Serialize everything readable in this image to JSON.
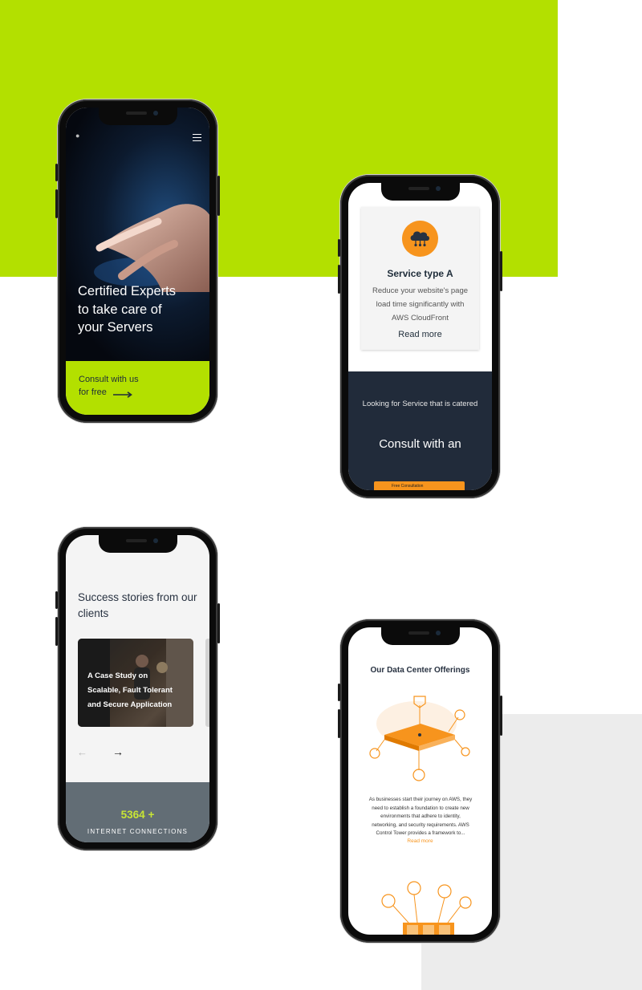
{
  "phone1": {
    "hero_title_lines": [
      "Certified Experts",
      "to take care of",
      "your Servers"
    ],
    "cta_lines": [
      "Consult with us",
      "for free"
    ],
    "menu_icon": "hamburger-menu-icon",
    "arrow_icon": "long-arrow-right-icon",
    "colors": {
      "accent": "#b3e000"
    }
  },
  "phone2": {
    "service_icon": "cloud-network-icon",
    "card_title": "Service type A",
    "card_desc_lines": [
      "Reduce your website's page",
      "load time significantly with",
      "AWS CloudFront"
    ],
    "card_link": "Read more",
    "navy_subtitle": "Looking for Service that is catered",
    "navy_title": "Consult with an",
    "navy_button": "Free Consultation",
    "colors": {
      "orange": "#f7941d",
      "navy": "#212b3a"
    }
  },
  "phone3": {
    "title_lines": [
      "Success stories from our",
      "clients"
    ],
    "case_title_lines": [
      "A Case Study on",
      "Scalable, Fault Tolerant",
      "and Secure Application"
    ],
    "prev_icon": "arrow-left-icon",
    "next_icon": "arrow-right-icon",
    "stat_number": "5364 +",
    "stat_label": "INTERNET CONNECTIONS",
    "colors": {
      "stats_bg": "#626d75",
      "stat_number": "#c8e535"
    }
  },
  "phone4": {
    "title": "Our Data Center Offerings",
    "text_lines": [
      "As businesses  start their journey on AWS, they",
      "need to establish a foundation to create new",
      "environments that adhere to identity,",
      "networking, and security requirements. AWS",
      "Control Tower provides a framework to..."
    ],
    "link": "Read more",
    "illustration_icon": "data-center-platform-icon",
    "illustration2_icon": "server-hub-icon"
  },
  "background": {
    "lime": "#b3e000",
    "gray": "#ececec"
  }
}
